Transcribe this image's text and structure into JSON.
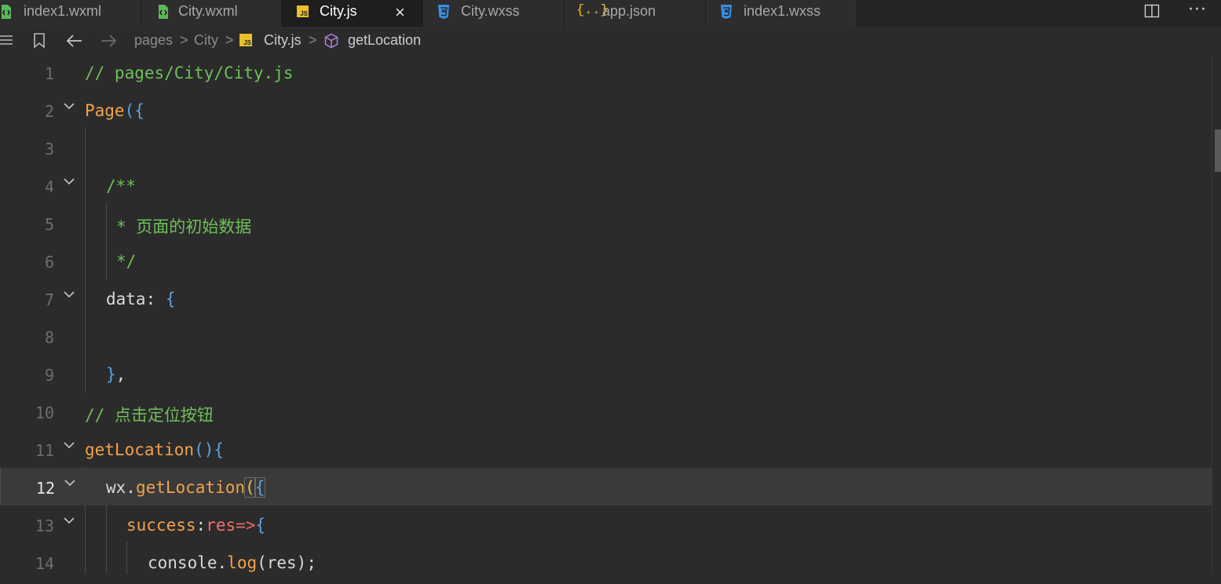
{
  "tabs": [
    {
      "label": "index1.wxml",
      "icon": "wxml-icon",
      "active": false
    },
    {
      "label": "City.wxml",
      "icon": "wxml-icon",
      "active": false
    },
    {
      "label": "City.js",
      "icon": "js-icon",
      "active": true,
      "icon_text": "JS"
    },
    {
      "label": "City.wxss",
      "icon": "css-icon",
      "active": false
    },
    {
      "label": "app.json",
      "icon": "json-icon",
      "active": false,
      "icon_text": "{..}"
    },
    {
      "label": "index1.wxss",
      "icon": "css-icon",
      "active": false
    }
  ],
  "tab_close": "×",
  "tab_more": "···",
  "breadcrumb": {
    "items": [
      "pages",
      "City",
      "City.js",
      "getLocation"
    ],
    "separator": ">",
    "js_badge": "JS"
  },
  "editor": {
    "current_line": 12,
    "lines": [
      {
        "n": "1",
        "text": "// pages/City/City.js"
      },
      {
        "n": "2",
        "a": "Page",
        "b": "({"
      },
      {
        "n": "3"
      },
      {
        "n": "4",
        "text": "/**"
      },
      {
        "n": "5",
        "text": "* 页面的初始数据"
      },
      {
        "n": "6",
        "text": "*/"
      },
      {
        "n": "7",
        "a": "data",
        "b": ": ",
        "c": "{"
      },
      {
        "n": "8"
      },
      {
        "n": "9",
        "a": "}",
        "b": ","
      },
      {
        "n": "10",
        "text": "// 点击定位按钮"
      },
      {
        "n": "11",
        "a": "getLocation",
        "b": "()",
        "c": "{"
      },
      {
        "n": "12",
        "a": "wx",
        "b": ".",
        "c": "getLocation",
        "d": "(",
        "e": "{"
      },
      {
        "n": "13",
        "a": "success",
        "b": ":",
        "c": "res",
        "d": "=>",
        "e": "{"
      },
      {
        "n": "14",
        "a": "console",
        "b": ".",
        "c": "log",
        "d": "(res);"
      }
    ]
  },
  "colors": {
    "comment": "#6fbf5a",
    "function": "#f2a24c",
    "keyword_brace": "#5da3e0",
    "background": "#2b2b2b",
    "css_icon": "#3b8fe6",
    "js_icon": "#e8c12b",
    "wxml_icon": "#5cb85c"
  }
}
